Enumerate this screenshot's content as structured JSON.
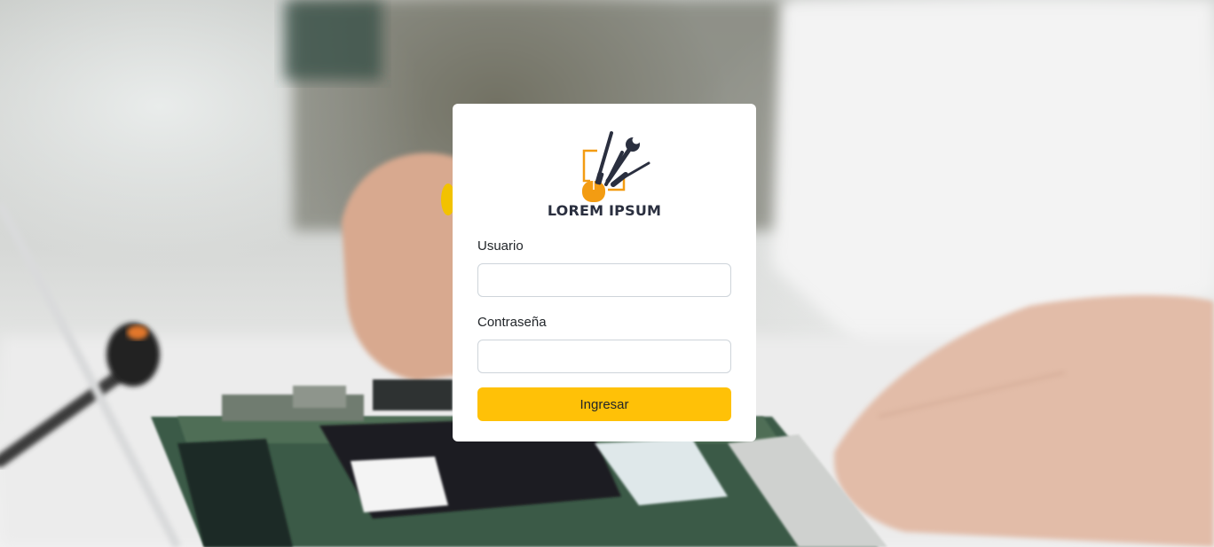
{
  "logo": {
    "text": "LOREM IPSUM",
    "icon": "tools-mouse-icon",
    "accent": "#f39c12",
    "dark": "#2a2f3f"
  },
  "form": {
    "username_label": "Usuario",
    "username_value": "",
    "password_label": "Contraseña",
    "password_value": "",
    "submit_label": "Ingresar"
  },
  "colors": {
    "button": "#ffc107",
    "card": "#ffffff"
  }
}
